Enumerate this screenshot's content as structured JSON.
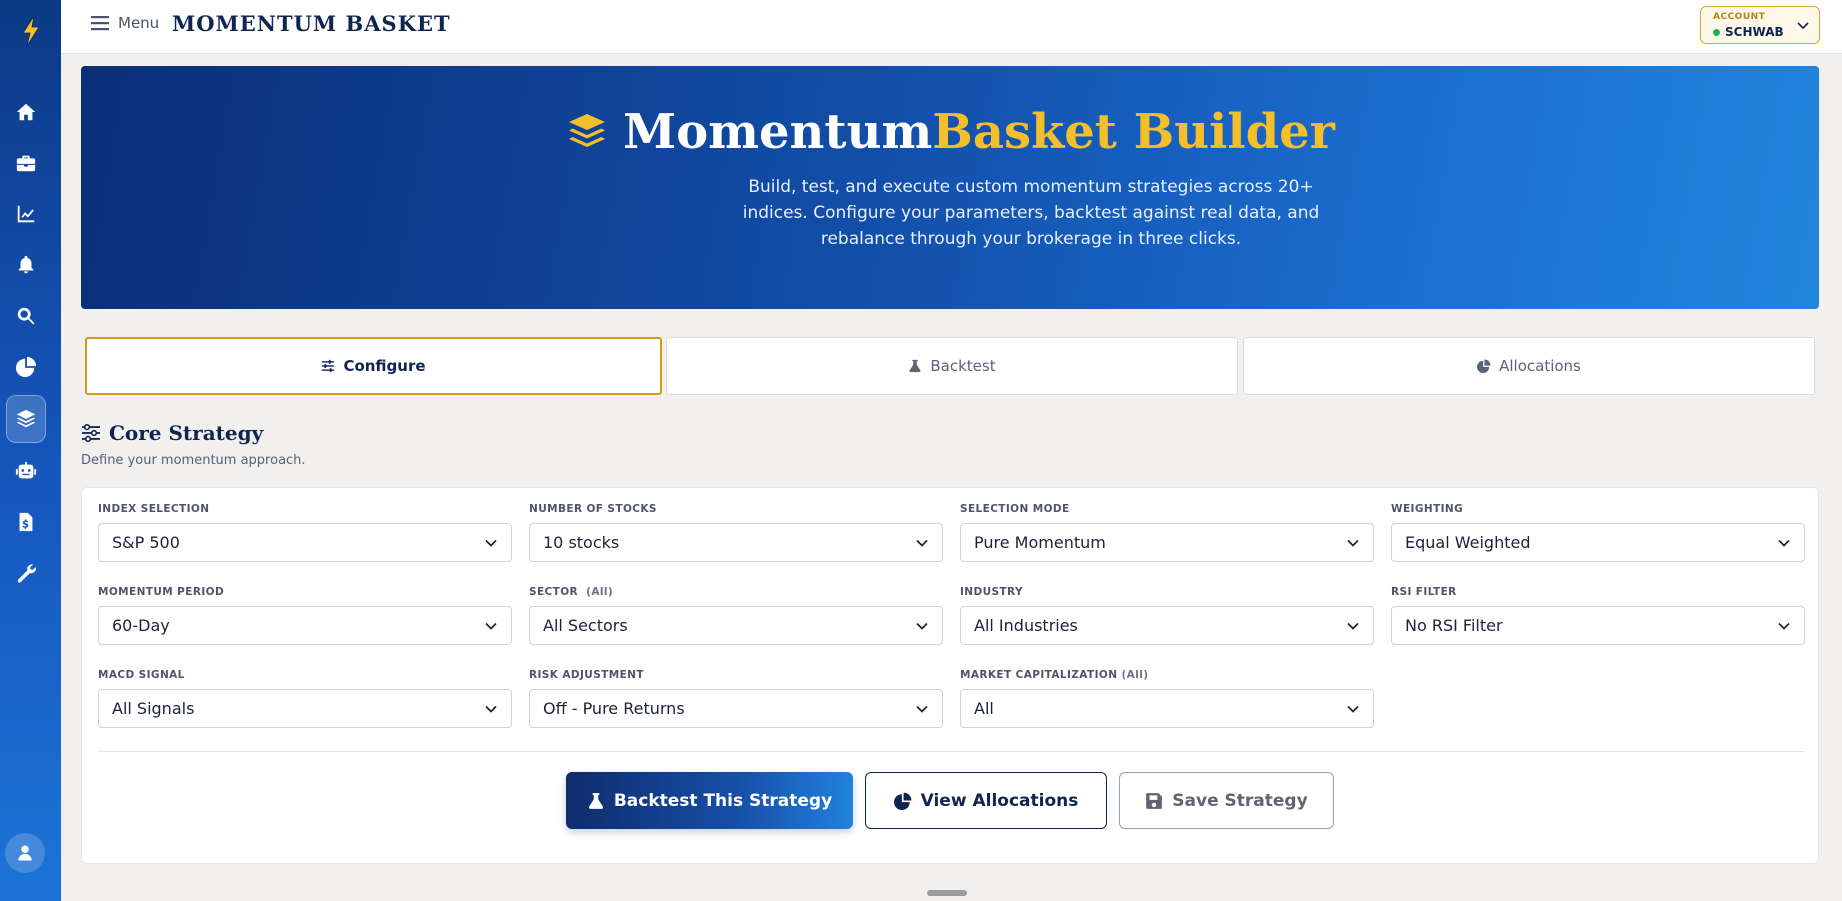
{
  "topbar": {
    "menu_label": "Menu",
    "brand": "MOMENTUM BASKET",
    "account_label": "ACCOUNT",
    "account_value": "SCHWAB",
    "account_status_color": "#22b04b"
  },
  "sidebar": {
    "items": [
      {
        "name": "home-icon"
      },
      {
        "name": "briefcase-icon"
      },
      {
        "name": "chart-line-icon"
      },
      {
        "name": "bell-icon"
      },
      {
        "name": "search-icon"
      },
      {
        "name": "pie-chart-icon"
      },
      {
        "name": "layers-icon",
        "active": true
      },
      {
        "name": "robot-icon"
      },
      {
        "name": "dollar-file-icon"
      },
      {
        "name": "tools-icon"
      }
    ],
    "user": "user-icon"
  },
  "hero": {
    "title_part1": "Momentum",
    "title_part2": "Basket Builder",
    "subtitle": "Build, test, and execute custom momentum strategies across 20+ indices. Configure your parameters, backtest against real data, and rebalance through your brokerage in three clicks.",
    "accent_color": "#f5be2b"
  },
  "tabs": [
    {
      "label": "Configure",
      "active": true
    },
    {
      "label": "Backtest",
      "active": false
    },
    {
      "label": "Allocations",
      "active": false
    }
  ],
  "section": {
    "title": "Core Strategy",
    "subtitle": "Define your momentum approach."
  },
  "fields": {
    "index_selection": {
      "label": "INDEX SELECTION",
      "value": "S&P 500"
    },
    "number_of_stocks": {
      "label": "NUMBER OF STOCKS",
      "value": "10 stocks"
    },
    "selection_mode": {
      "label": "SELECTION MODE",
      "value": "Pure Momentum"
    },
    "weighting": {
      "label": "WEIGHTING",
      "value": "Equal Weighted"
    },
    "momentum_period": {
      "label": "MOMENTUM PERIOD",
      "value": "60-Day"
    },
    "sector": {
      "label": "SECTOR",
      "label_note": "(All)",
      "value": "All Sectors"
    },
    "industry": {
      "label": "INDUSTRY",
      "value": "All Industries"
    },
    "rsi_filter": {
      "label": "RSI FILTER",
      "value": "No RSI Filter"
    },
    "macd_signal": {
      "label": "MACD SIGNAL",
      "value": "All Signals"
    },
    "risk_adjustment": {
      "label": "RISK ADJUSTMENT",
      "value": "Off - Pure Returns"
    },
    "market_cap": {
      "label": "MARKET CAPITALIZATION",
      "label_note": "(All)",
      "value": "All"
    }
  },
  "actions": {
    "backtest": "Backtest This Strategy",
    "view_allocations": "View Allocations",
    "save": "Save Strategy"
  }
}
